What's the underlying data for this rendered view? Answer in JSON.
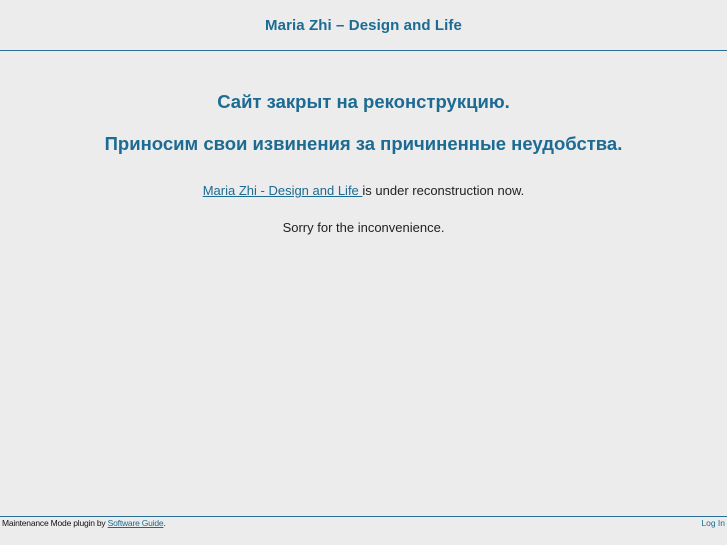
{
  "header": {
    "site_title": "Maria Zhi – Design and Life"
  },
  "main": {
    "heading_1": "Сайт закрыт на реконструкцию.",
    "heading_2": "Приносим свои извинения за причиненные неудобства.",
    "message_link": "Maria Zhi - Design and Life ",
    "message_rest": " is under reconstruction now.",
    "message_2": "Sorry for the inconvenience."
  },
  "footer": {
    "credit_prefix": "Maintenance Mode plugin by ",
    "credit_link": "Software Guide",
    "credit_suffix": ".",
    "login_label": "Log In"
  },
  "colors": {
    "accent": "#1d6a92",
    "background": "#ececec",
    "rule": "#2a6f97"
  }
}
